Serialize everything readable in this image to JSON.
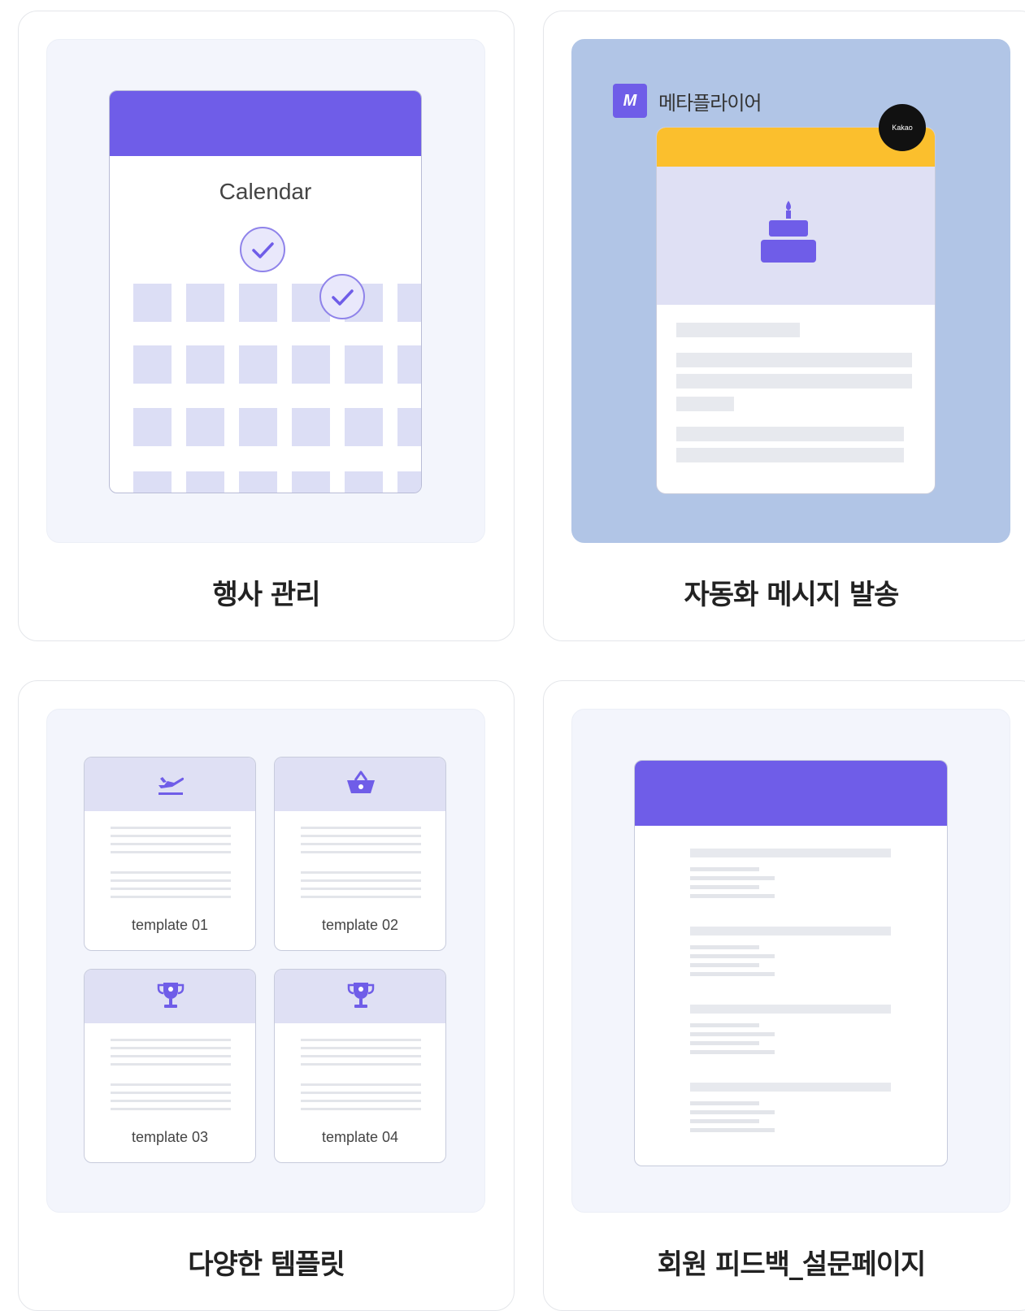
{
  "cards": [
    {
      "caption": "행사 관리",
      "calendar_title": "Calendar"
    },
    {
      "caption": "자동화 메시지 발송",
      "logo_letter": "M",
      "logo_text": "메타플라이어",
      "badge": "Kakao"
    },
    {
      "caption": "다양한 템플릿",
      "templates": [
        "template 01",
        "template 02",
        "template 03",
        "template 04"
      ],
      "template_icons": [
        "airplane-icon",
        "basket-icon",
        "trophy-icon",
        "trophy-icon"
      ]
    },
    {
      "caption": "회원 피드백_설문페이지"
    }
  ],
  "colors": {
    "accent": "#6f5de8",
    "kakao_yellow": "#fbbf2d",
    "panel": "#f3f5fc",
    "panel_blue": "#b1c5e6"
  }
}
